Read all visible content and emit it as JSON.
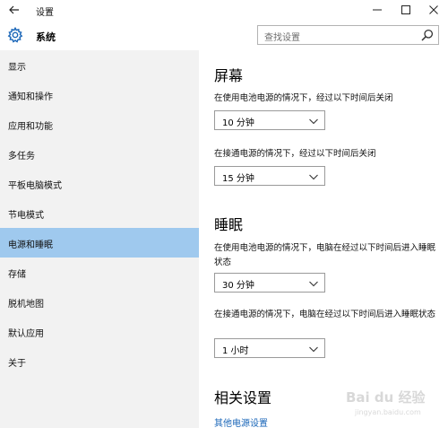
{
  "window": {
    "title": "设置"
  },
  "header": {
    "app_title": "系统",
    "search_placeholder": "查找设置"
  },
  "sidebar": {
    "items": [
      {
        "label": "显示",
        "active": false
      },
      {
        "label": "通知和操作",
        "active": false
      },
      {
        "label": "应用和功能",
        "active": false
      },
      {
        "label": "多任务",
        "active": false
      },
      {
        "label": "平板电脑模式",
        "active": false
      },
      {
        "label": "节电模式",
        "active": false
      },
      {
        "label": "电源和睡眠",
        "active": true
      },
      {
        "label": "存储",
        "active": false
      },
      {
        "label": "脱机地图",
        "active": false
      },
      {
        "label": "默认应用",
        "active": false
      },
      {
        "label": "关于",
        "active": false
      }
    ]
  },
  "main": {
    "screen": {
      "heading": "屏幕",
      "battery_label": "在使用电池电源的情况下，经过以下时间后关闭",
      "battery_value": "10 分钟",
      "plugged_label": "在接通电源的情况下，经过以下时间后关闭",
      "plugged_value": "15 分钟"
    },
    "sleep": {
      "heading": "睡眠",
      "battery_label": "在使用电池电源的情况下，电脑在经过以下时间后进入睡眠状态",
      "battery_value": "30 分钟",
      "plugged_label": "在接通电源的情况下，电脑在经过以下时间后进入睡眠状态",
      "plugged_value": "1 小时"
    },
    "related": {
      "heading": "相关设置",
      "link": "其他电源设置"
    }
  },
  "watermark": {
    "line1": "Bai du 经验",
    "line2": "jingyan.baidu.com"
  },
  "colors": {
    "sidebar_bg": "#f2f2f2",
    "active_bg": "#9fc9ee",
    "link": "#1a66b8",
    "accent": "#1a66b8"
  }
}
